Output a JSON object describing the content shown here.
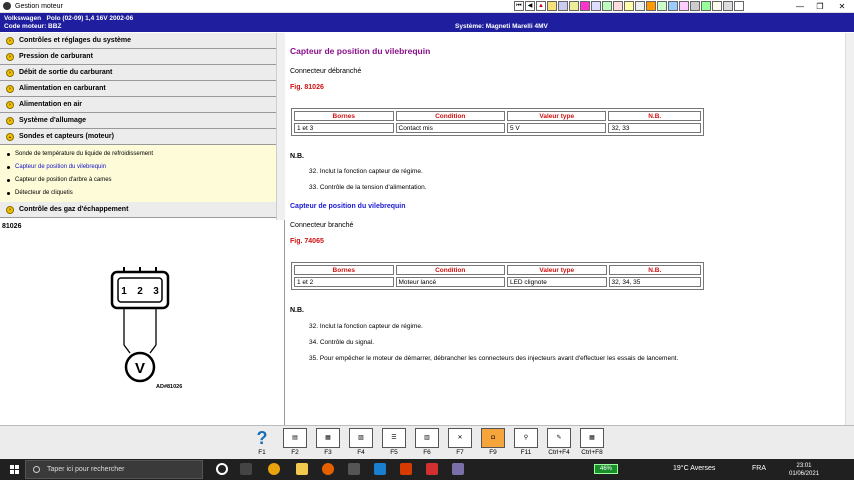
{
  "window": {
    "title": "Gestion moteur"
  },
  "infobar": {
    "make": "Volkswagen",
    "model": "Polo (02-09) 1,4 16V 2002-06",
    "engine_code": "Code moteur: BBZ",
    "system": "Système: Magneti Marelli 4MV"
  },
  "menu": {
    "items_top": [
      "Contrôles et réglages du système",
      "Pression de carburant",
      "Débit de sortie du carburant",
      "Alimentation en carburant",
      "Alimentation en air",
      "Système d'allumage",
      "Sondes et capteurs (moteur)"
    ],
    "sub_items": [
      "Sonde de température du liquide de refroidissement",
      "Capteur de position du vilebrequin",
      "Capteur de position d'arbre à cames",
      "Détecteur de cliquetis"
    ],
    "item_bottom": "Contrôle des gaz d'échappement"
  },
  "figure": {
    "code": "81026",
    "caption": "AD#81026",
    "pins": [
      "1",
      "2",
      "3"
    ],
    "meter": "V"
  },
  "content": {
    "section1": {
      "title": "Capteur de position du vilebrequin",
      "state": "Connecteur débranché",
      "fig": "Fig. 81026",
      "headers": [
        "Bornes",
        "Condition",
        "Valeur type",
        "N.B."
      ],
      "row": [
        "1 et 3",
        "Contact mis",
        "5 V",
        "32, 33"
      ],
      "nb_label": "N.B.",
      "notes": [
        "32. Inclut la fonction capteur de régime.",
        "33. Contrôle de la tension d'alimentation."
      ]
    },
    "section2": {
      "title": "Capteur de position du vilebrequin",
      "state": "Connecteur branché",
      "fig": "Fig. 74065",
      "headers": [
        "Bornes",
        "Condition",
        "Valeur type",
        "N.B."
      ],
      "row": [
        "1 et 2",
        "Moteur lancé",
        "LED clignote",
        "32, 34, 35"
      ],
      "nb_label": "N.B.",
      "notes": [
        "32. Inclut la fonction capteur de régime.",
        "34. Contrôle du signal.",
        "35. Pour empêcher le moteur de démarrer, débrancher les connecteurs des injecteurs avant d'effectuer les essais de lancement."
      ]
    }
  },
  "fkeys": [
    "F1",
    "F2",
    "F3",
    "F4",
    "F5",
    "F6",
    "F7",
    "F9",
    "F11",
    "Ctrl+F4",
    "Ctrl+F8"
  ],
  "taskbar": {
    "search_placeholder": "Taper ici pour rechercher",
    "battery": "46%",
    "weather": "19°C  Averses",
    "lang": "FRA",
    "time": "23:01",
    "date": "01/06/2021"
  },
  "colors": {
    "infobar": "#1e1e9e",
    "section_title": "#8b0f8b",
    "subtitle": "#1a1ad0",
    "fig_ref": "#d01010",
    "submenu_bg": "#fdfbd8"
  }
}
